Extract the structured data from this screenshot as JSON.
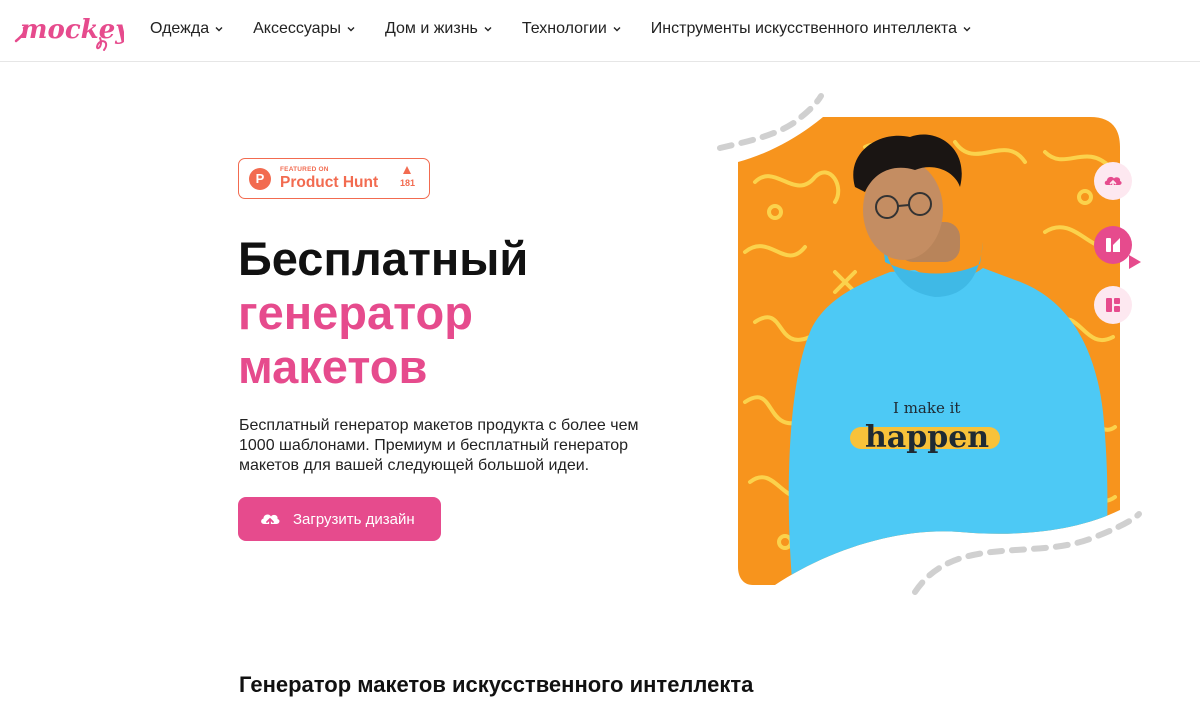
{
  "brand": {
    "logo_text": "mockey",
    "accent": "#e64b8d"
  },
  "nav": {
    "items": [
      {
        "label": "Одежда"
      },
      {
        "label": "Аксессуары"
      },
      {
        "label": "Дом и жизнь"
      },
      {
        "label": "Технологии"
      },
      {
        "label": "Инструменты искусственного интеллекта"
      }
    ]
  },
  "product_hunt": {
    "featured": "FEATURED ON",
    "name": "Product Hunt",
    "votes": "181"
  },
  "hero": {
    "title_line1": "Бесплатный",
    "title_line2": "генератор",
    "title_line3": "макетов",
    "description": "Бесплатный генератор макетов продукта с более чем 1000 шаблонами. Премиум и бесплатный генератор макетов для вашей следующей большой идеи.",
    "cta_label": "Загрузить дизайн",
    "shirt_line1": "I make it",
    "shirt_line2": "happen"
  },
  "section": {
    "title": "Генератор макетов искусственного интеллекта"
  },
  "icons": {
    "side1": "upload-cloud-icon",
    "side2": "template-icon",
    "side3": "layout-grid-icon"
  }
}
